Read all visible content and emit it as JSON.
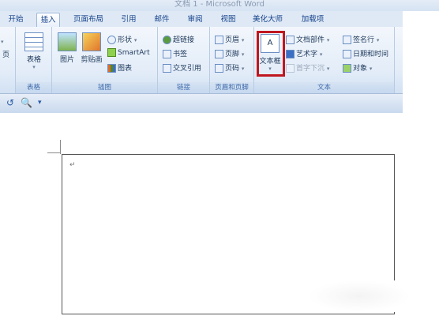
{
  "window": {
    "title": "文档 1 - Microsoft Word"
  },
  "tabs": [
    {
      "label": "开始"
    },
    {
      "label": "插入"
    },
    {
      "label": "页面布局"
    },
    {
      "label": "引用"
    },
    {
      "label": "邮件"
    },
    {
      "label": "审阅"
    },
    {
      "label": "视图"
    },
    {
      "label": "美化大师"
    },
    {
      "label": "加载项"
    }
  ],
  "active_tab": "插入",
  "groups": {
    "table": {
      "label": "表格",
      "button": "表格"
    },
    "illustrations": {
      "label": "插图",
      "picture": "图片",
      "clipart": "剪贴画",
      "shapes": "形状",
      "smartart": "SmartArt",
      "chart": "图表"
    },
    "links": {
      "label": "链接",
      "hyperlink": "超链接",
      "bookmark": "书签",
      "crossref": "交叉引用"
    },
    "header_footer": {
      "label": "页眉和页脚",
      "header": "页眉",
      "footer": "页脚",
      "pagenum": "页码"
    },
    "text": {
      "label": "文本",
      "textbox": "文本框",
      "quickparts": "文档部件",
      "wordart": "艺术字",
      "dropcap": "首字下沉",
      "signature": "签名行",
      "datetime": "日期和时间",
      "object": "对象"
    }
  },
  "left_stub": "页",
  "document": {
    "paragraph_mark": "↵"
  },
  "colors": {
    "highlight": "#c0161f",
    "ribbon": "#dfe9f5"
  },
  "icons": [
    "undo-icon",
    "print-preview-icon",
    "customize-qat-icon"
  ]
}
